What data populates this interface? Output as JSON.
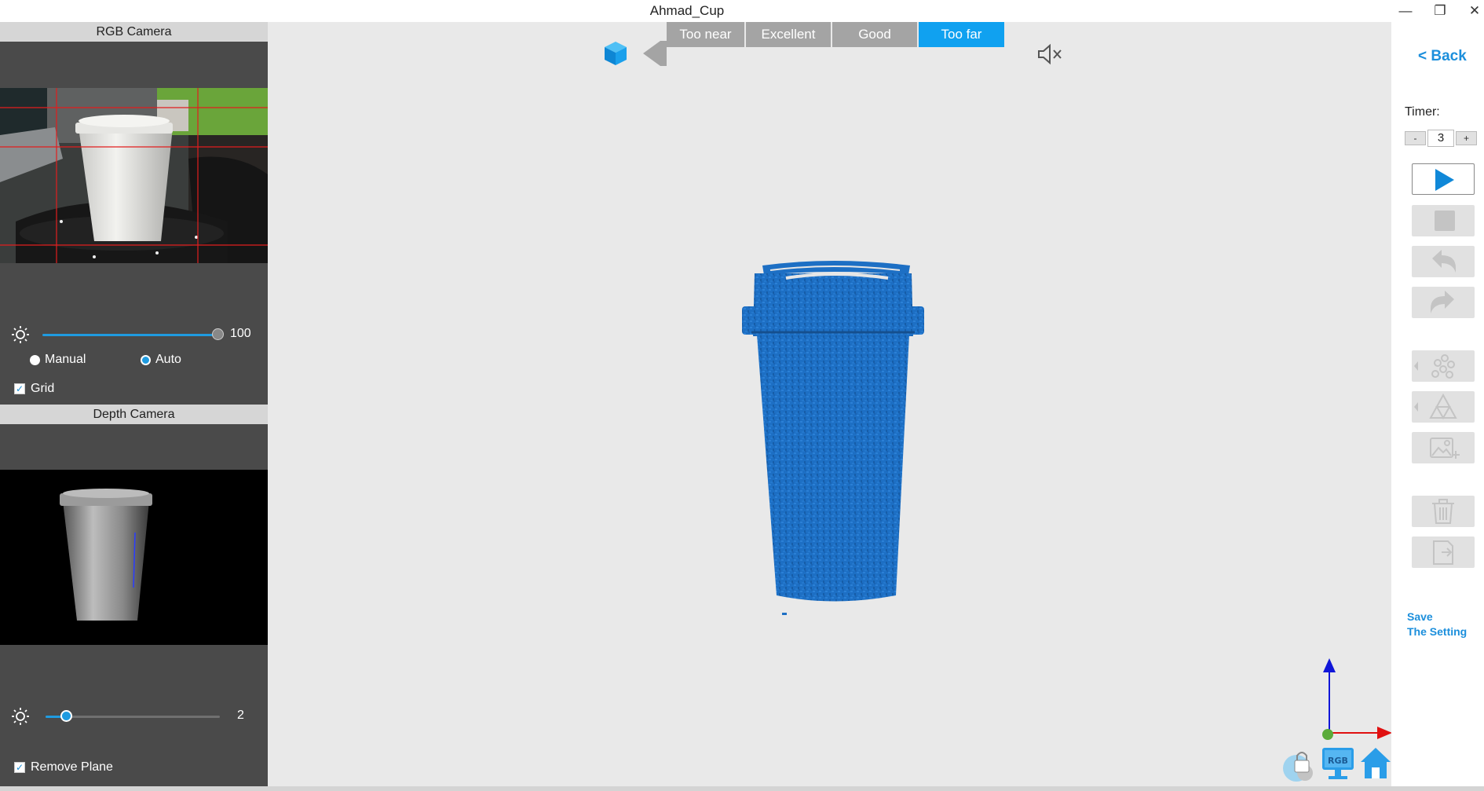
{
  "window": {
    "title": "Ahmad_Cup",
    "minimize": "—",
    "restore": "❐",
    "close": "✕"
  },
  "left": {
    "rgb_header": "RGB Camera",
    "rgb_brightness_value": "100",
    "rgb_brightness_fraction": 1.0,
    "manual_label": "Manual",
    "auto_label": "Auto",
    "exposure_mode": "Auto",
    "grid_label": "Grid",
    "grid_checked": true,
    "depth_header": "Depth Camera",
    "depth_brightness_value": "2",
    "depth_brightness_fraction": 0.1,
    "remove_plane_label": "Remove Plane",
    "remove_plane_checked": true
  },
  "distance": {
    "segments": [
      "Too near",
      "Excellent",
      "Good",
      "Too far"
    ],
    "active": "Too far"
  },
  "icons": {
    "cube": "cube-icon",
    "sound": "mute-icon",
    "play": "play-icon",
    "stop": "stop-icon",
    "undo": "undo-icon",
    "redo": "redo-icon",
    "points": "point-cloud-icon",
    "mesh": "mesh-icon",
    "texture": "add-image-icon",
    "delete": "trash-icon",
    "export": "export-icon",
    "lock": "lock-icon",
    "rgb": "rgb-monitor-icon",
    "home": "home-icon"
  },
  "right": {
    "back_label": "< Back",
    "timer_label": "Timer:",
    "timer_minus": "-",
    "timer_value": "3",
    "timer_plus": "+",
    "save_line1": "Save",
    "save_line2": "The Setting"
  },
  "badges": {
    "rgb_text": "RGB"
  },
  "colors": {
    "accent": "#10a1f0",
    "model_blue": "#1d6fc4",
    "panel_dark": "#4a4a4a",
    "viewport_bg": "#e9e9e9",
    "button_gray": "#e1e1e1"
  }
}
